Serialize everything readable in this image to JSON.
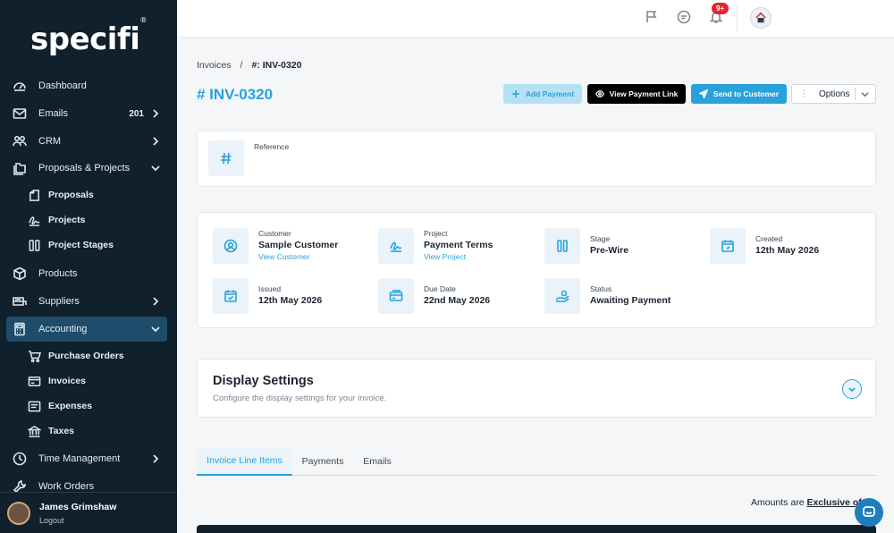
{
  "brand": {
    "logo_text": "specifi"
  },
  "sidebar": {
    "items": [
      {
        "label": "Dashboard",
        "icon": "dashboard-icon"
      },
      {
        "label": "Emails",
        "count": "201",
        "icon": "mail-icon"
      },
      {
        "label": "CRM",
        "icon": "people-icon"
      },
      {
        "label": "Proposals & Projects",
        "icon": "folders-icon",
        "expanded": true
      },
      {
        "label": "Products",
        "icon": "box-icon"
      },
      {
        "label": "Suppliers",
        "icon": "truck-icon"
      },
      {
        "label": "Accounting",
        "icon": "calculator-icon",
        "expanded": true,
        "active": true
      },
      {
        "label": "Time Management",
        "icon": "clock-icon"
      },
      {
        "label": "Work Orders",
        "icon": "wrench-icon"
      }
    ],
    "proposals_sub": [
      {
        "label": "Proposals",
        "icon": "proposal-icon"
      },
      {
        "label": "Projects",
        "icon": "signature-icon"
      },
      {
        "label": "Project Stages",
        "icon": "columns-icon"
      }
    ],
    "accounting_sub": [
      {
        "label": "Purchase Orders",
        "icon": "cart-icon"
      },
      {
        "label": "Invoices",
        "icon": "invoice-icon"
      },
      {
        "label": "Expenses",
        "icon": "receipt-icon"
      },
      {
        "label": "Taxes",
        "icon": "bank-icon"
      }
    ],
    "user": {
      "name": "James Grimshaw",
      "logout": "Logout"
    }
  },
  "topbar": {
    "notification_badge": "9+"
  },
  "breadcrumb": {
    "parent": "Invoices",
    "separator": "/",
    "current": "#: INV-0320"
  },
  "page": {
    "title": "# INV-0320"
  },
  "actions": {
    "add_payment": "Add Payment",
    "view_payment_link": "View Payment Link",
    "send_to_customer": "Send to Customer",
    "options": "Options"
  },
  "reference": {
    "label": "Reference",
    "value": ""
  },
  "details": {
    "customer": {
      "title": "Customer",
      "value": "Sample Customer",
      "link": "View Customer"
    },
    "project": {
      "title": "Project",
      "value": "Payment Terms",
      "link": "View Project"
    },
    "stage": {
      "title": "Stage",
      "value": "Pre-Wire"
    },
    "created": {
      "title": "Created",
      "value": "12th May 2026"
    },
    "issued": {
      "title": "Issued",
      "value": "12th May 2026"
    },
    "due": {
      "title": "Due Date",
      "value": "22nd May 2026"
    },
    "status": {
      "title": "Status",
      "value": "Awaiting Payment"
    }
  },
  "display_settings": {
    "title": "Display Settings",
    "subtitle": "Configure the display settings for your invoice."
  },
  "tabs": [
    "Invoice Line Items",
    "Payments",
    "Emails"
  ],
  "amounts": {
    "prefix": "Amounts are",
    "mode": "Exclusive of"
  },
  "colors": {
    "accent": "#29a2db",
    "sidebar": "#10202c",
    "active": "#1e4c6a"
  }
}
